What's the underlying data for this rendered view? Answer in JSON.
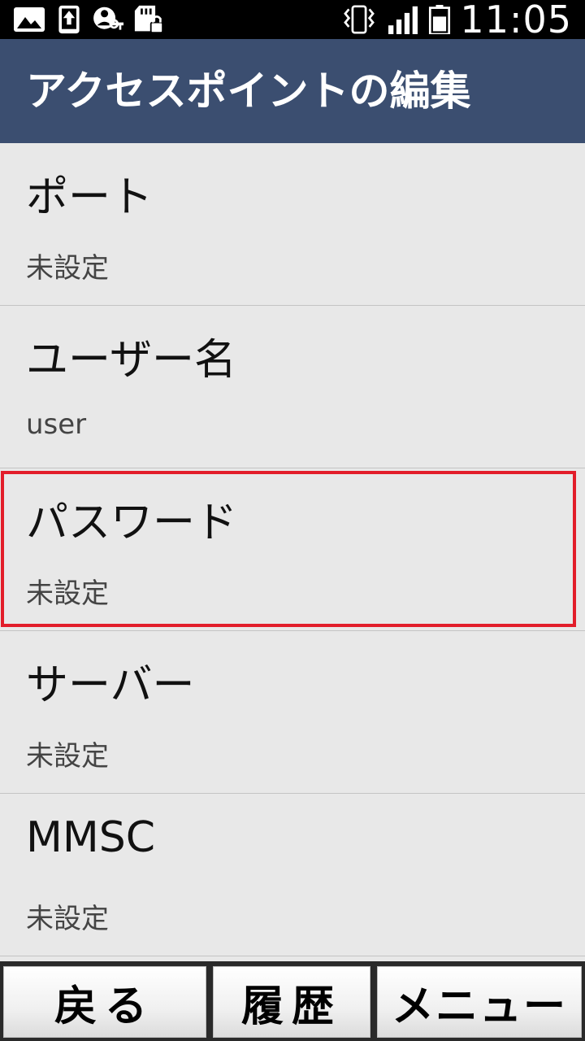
{
  "status_bar": {
    "time": "11:05",
    "icons": [
      "image-icon",
      "upload-icon",
      "vpn-key-icon",
      "sd-card-lock-icon",
      "vibrate-icon",
      "signal-icon",
      "battery-icon"
    ]
  },
  "header": {
    "title": "アクセスポイントの編集",
    "color": "#3b4e70"
  },
  "settings": {
    "items": [
      {
        "title": "ポート",
        "value": "未設定"
      },
      {
        "title": "ユーザー名",
        "value": "user"
      },
      {
        "title": "パスワード",
        "value": "未設定",
        "highlighted": true
      },
      {
        "title": "サーバー",
        "value": "未設定"
      },
      {
        "title": "MMSC",
        "value": "未設定"
      }
    ],
    "highlight_color": "#e21d2a"
  },
  "softkeys": {
    "back": "戻る",
    "history": "履歴",
    "menu": "メニュー"
  }
}
